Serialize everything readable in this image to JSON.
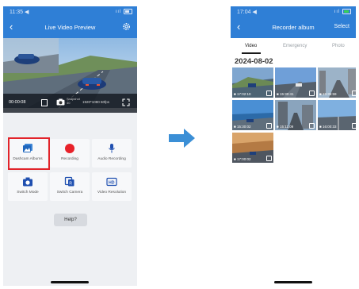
{
  "left_screen": {
    "status_time": "11:35 ◀",
    "status_signal": "ııl",
    "title": "Live Video Preview",
    "control_bar": {
      "time": "00:00:08",
      "snapshot_label": "Snapshot 40",
      "resolution": "1920*1080 60fps"
    },
    "buttons": [
      {
        "label": "Dashcam Albums",
        "icon": "album-icon"
      },
      {
        "label": "Recording",
        "icon": "record-icon"
      },
      {
        "label": "Audio Recording",
        "icon": "microphone-icon"
      },
      {
        "label": "Switch Mode",
        "icon": "camera-icon"
      },
      {
        "label": "Switch Camera",
        "icon": "switch-camera-icon"
      },
      {
        "label": "Video Resolution",
        "icon": "hd-icon"
      }
    ],
    "help_label": "Help?"
  },
  "right_screen": {
    "status_time": "17:04 ◀",
    "status_signal": "ııl",
    "title": "Recorder album",
    "select_label": "Select",
    "tabs": [
      "Video",
      "Emergency",
      "Photo"
    ],
    "active_tab": "Video",
    "date_heading": "2024-08-02",
    "thumbnails": [
      {
        "time": "■ 17:02:10"
      },
      {
        "time": "■ 15:30:41"
      },
      {
        "time": "■ 15:35:59"
      },
      {
        "time": "■ 15:30:02"
      },
      {
        "time": "■ 15:11:09"
      },
      {
        "time": "■ 16:00:33"
      },
      {
        "time": "■ 17:00:02"
      }
    ]
  },
  "colors": {
    "accent": "#2f7fd6",
    "highlight": "#e2232a",
    "record_red": "#e8222a",
    "arrow_blue": "#3b8fd6"
  }
}
